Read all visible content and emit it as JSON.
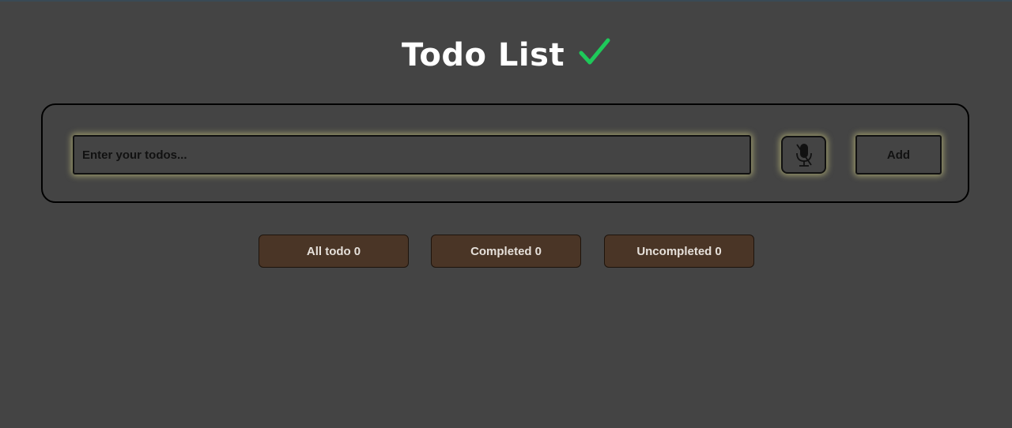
{
  "header": {
    "title": "Todo List",
    "check_icon": "check-mark-icon",
    "check_color": "#1ec95a"
  },
  "input_card": {
    "todo_input": {
      "value": "",
      "placeholder": "Enter your todos..."
    },
    "mic_button": {
      "icon": "microphone-off-icon"
    },
    "add_label": "Add"
  },
  "filters": {
    "all": {
      "label": "All todo",
      "count": "0"
    },
    "completed": {
      "label": "Completed",
      "count": "0"
    },
    "uncompleted": {
      "label": "Uncompleted",
      "count": "0"
    }
  },
  "colors": {
    "background": "#444444",
    "filter_button": "#4a3526",
    "glow": "#e6e28c"
  }
}
